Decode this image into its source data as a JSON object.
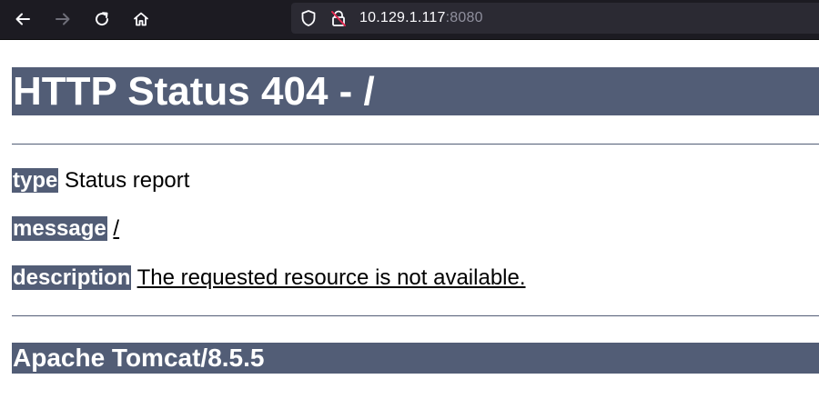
{
  "browser": {
    "url_host": "10.129.1.117",
    "url_port": ":8080",
    "colors": {
      "toolbar_bg": "#1c1b22",
      "urlbar_bg": "#2b2a33",
      "insecure_lock": "#e22850"
    },
    "icons": [
      "back-arrow-icon",
      "forward-arrow-icon",
      "reload-icon",
      "home-icon",
      "shield-icon",
      "insecure-lock-icon"
    ]
  },
  "page": {
    "title": "HTTP Status 404 - /",
    "type_label": "type",
    "type_value": "Status report",
    "message_label": "message",
    "message_value": "/",
    "description_label": "description",
    "description_value": "The requested resource is not available.",
    "footer": "Apache Tomcat/8.5.5",
    "accent_color": "#525d76"
  }
}
